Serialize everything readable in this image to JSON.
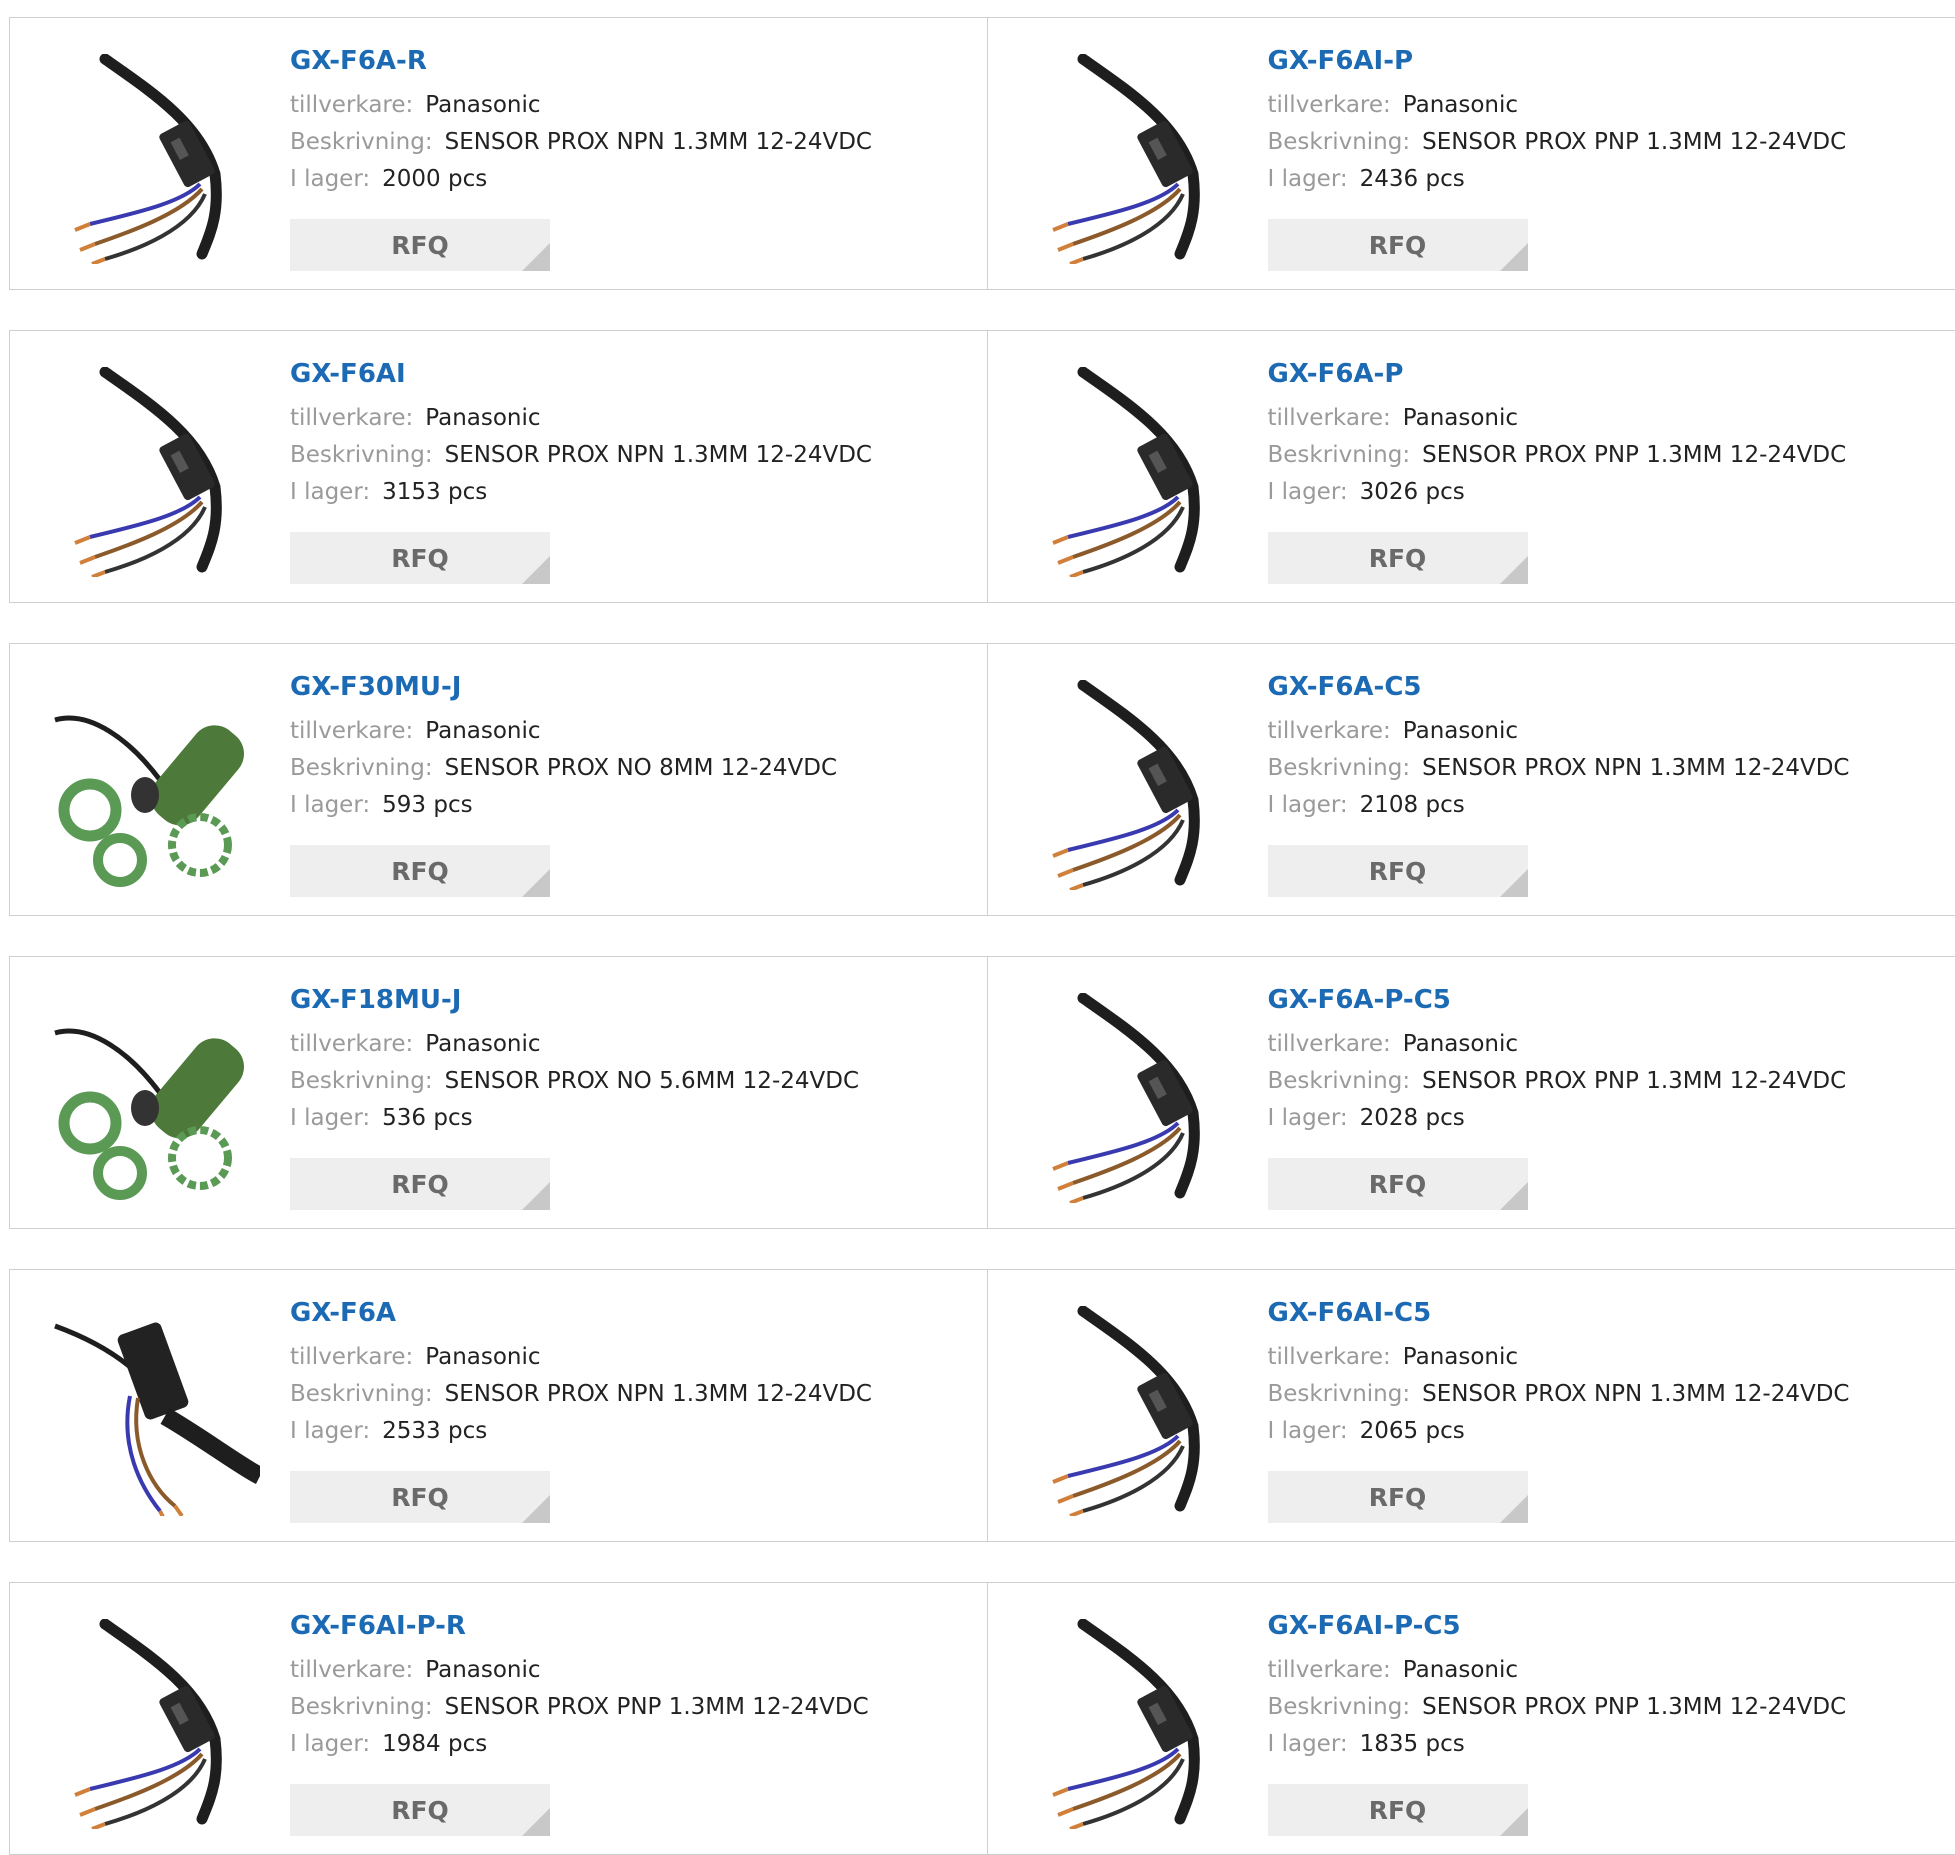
{
  "labels": {
    "manufacturer": "tillverkare:",
    "description": "Beskrivning:",
    "stock": "I lager:",
    "rfq": "RFQ"
  },
  "products": [
    {
      "part": "GX-F6A-R",
      "manufacturer": "Panasonic",
      "description": "SENSOR PROX NPN 1.3MM 12-24VDC",
      "stock": "2000 pcs",
      "image": "cable-sensor-image"
    },
    {
      "part": "GX-F6AI-P",
      "manufacturer": "Panasonic",
      "description": "SENSOR PROX PNP 1.3MM 12-24VDC",
      "stock": "2436 pcs",
      "image": "cable-sensor-image"
    },
    {
      "part": "GX-F6AI",
      "manufacturer": "Panasonic",
      "description": "SENSOR PROX NPN 1.3MM 12-24VDC",
      "stock": "3153 pcs",
      "image": "cable-sensor-image"
    },
    {
      "part": "GX-F6A-P",
      "manufacturer": "Panasonic",
      "description": "SENSOR PROX PNP 1.3MM 12-24VDC",
      "stock": "3026 pcs",
      "image": "cable-sensor-image"
    },
    {
      "part": "GX-F30MU-J",
      "manufacturer": "Panasonic",
      "description": "SENSOR PROX NO 8MM 12-24VDC",
      "stock": "593 pcs",
      "image": "cylinder-sensor-image"
    },
    {
      "part": "GX-F6A-C5",
      "manufacturer": "Panasonic",
      "description": "SENSOR PROX NPN 1.3MM 12-24VDC",
      "stock": "2108 pcs",
      "image": "cable-sensor-image"
    },
    {
      "part": "GX-F18MU-J",
      "manufacturer": "Panasonic",
      "description": "SENSOR PROX NO 5.6MM 12-24VDC",
      "stock": "536 pcs",
      "image": "cylinder-sensor-image"
    },
    {
      "part": "GX-F6A-P-C5",
      "manufacturer": "Panasonic",
      "description": "SENSOR PROX PNP 1.3MM 12-24VDC",
      "stock": "2028 pcs",
      "image": "cable-sensor-image"
    },
    {
      "part": "GX-F6A",
      "manufacturer": "Panasonic",
      "description": "SENSOR PROX NPN 1.3MM 12-24VDC",
      "stock": "2533 pcs",
      "image": "angled-sensor-image"
    },
    {
      "part": "GX-F6AI-C5",
      "manufacturer": "Panasonic",
      "description": "SENSOR PROX NPN 1.3MM 12-24VDC",
      "stock": "2065 pcs",
      "image": "cable-sensor-image"
    },
    {
      "part": "GX-F6AI-P-R",
      "manufacturer": "Panasonic",
      "description": "SENSOR PROX PNP 1.3MM 12-24VDC",
      "stock": "1984 pcs",
      "image": "cable-sensor-image"
    },
    {
      "part": "GX-F6AI-P-C5",
      "manufacturer": "Panasonic",
      "description": "SENSOR PROX PNP 1.3MM 12-24VDC",
      "stock": "1835 pcs",
      "image": "cable-sensor-image"
    }
  ],
  "colors": {
    "link": "#1c6ab3",
    "label": "#9a9a9a",
    "border": "#cfcfcf",
    "button_bg": "#eeeeee"
  }
}
